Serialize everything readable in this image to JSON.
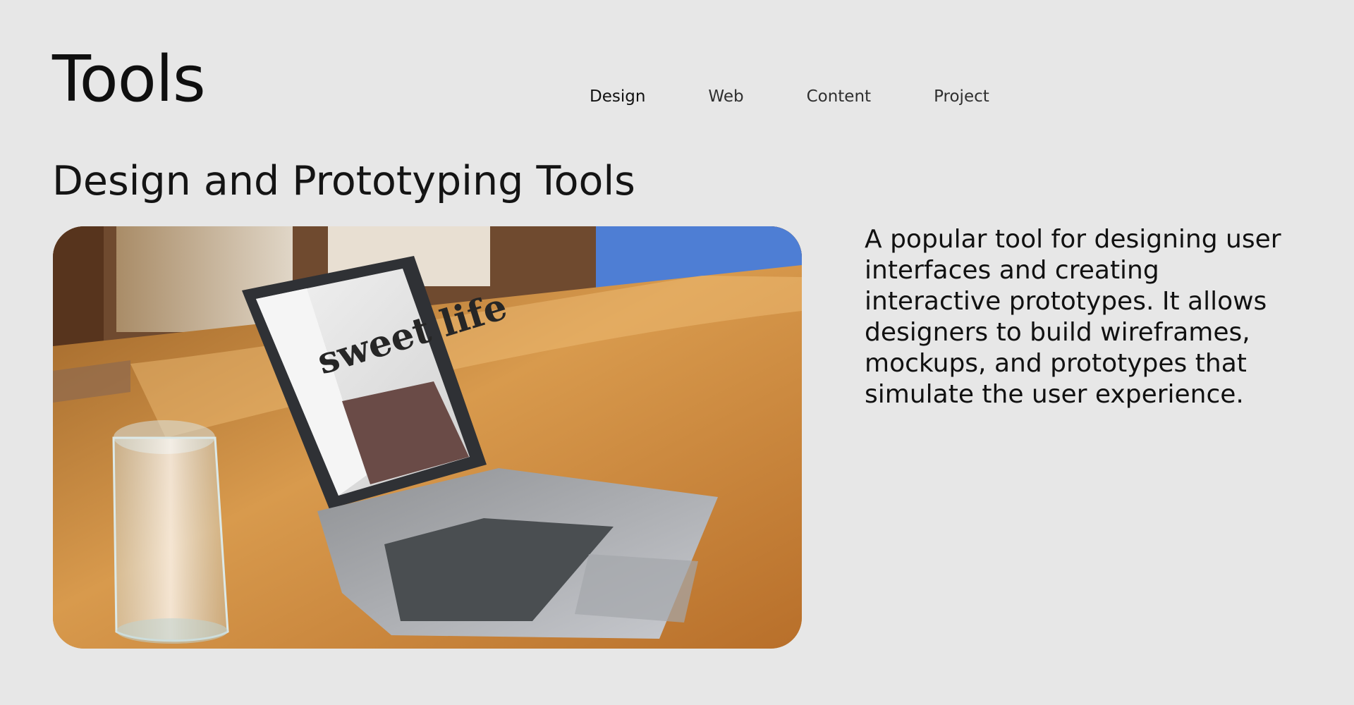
{
  "header": {
    "title": "Tools"
  },
  "nav": {
    "items": [
      {
        "label": "Design",
        "active": true
      },
      {
        "label": "Web",
        "active": false
      },
      {
        "label": "Content",
        "active": false
      },
      {
        "label": "Project",
        "active": false
      }
    ]
  },
  "section": {
    "title": "Design and Prototyping Tools",
    "description": "A popular tool for designing user interfaces and creating interactive prototypes. It allows designers to build wireframes, mockups, and prototypes that simulate the user experience."
  },
  "image": {
    "screen_text": "sweet life"
  },
  "colors": {
    "background": "#e7e7e7",
    "text": "#111111",
    "wood": "#c9883d"
  }
}
